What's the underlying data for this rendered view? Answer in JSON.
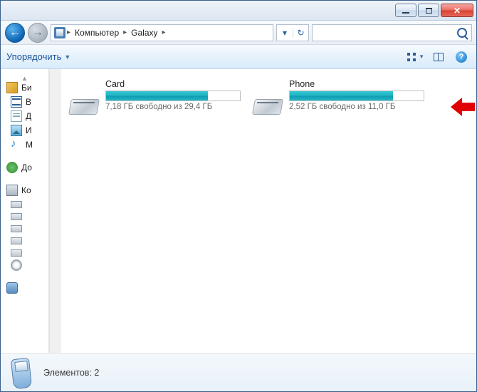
{
  "breadcrumb": {
    "root": "Компьютер",
    "folder": "Galaxy"
  },
  "toolbar": {
    "organize_label": "Упорядочить"
  },
  "sidebar": {
    "libraries": "Би",
    "videos": "В",
    "documents": "Д",
    "pictures": "И",
    "music": "М",
    "homegroup": "До",
    "computer": "Ко"
  },
  "drives": [
    {
      "name": "Card",
      "free_text": "7,18 ГБ свободно из 29,4 ГБ",
      "fill_pct": 76
    },
    {
      "name": "Phone",
      "free_text": "2,52 ГБ свободно из 11,0 ГБ",
      "fill_pct": 77
    }
  ],
  "details": {
    "items_label": "Элементов: 2"
  }
}
